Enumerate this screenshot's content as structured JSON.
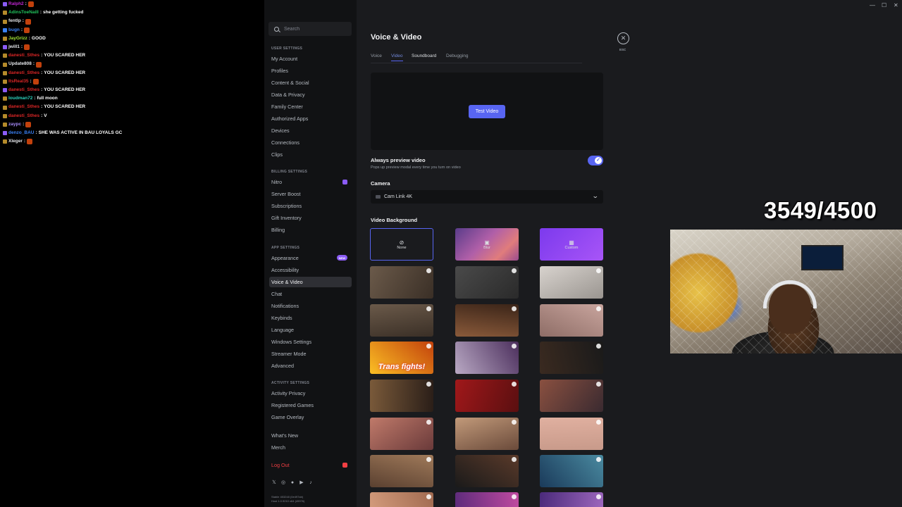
{
  "chat": {
    "lines": [
      {
        "user": "Ralph2",
        "msg": "",
        "color": "#c026d3"
      },
      {
        "user": "AdinsToeNaill",
        "msg": "she getting fucked",
        "color": "#22c55e"
      },
      {
        "user": "fentlp",
        "msg": "",
        "color": "#e5e7eb"
      },
      {
        "user": "bugn",
        "msg": "",
        "color": "#3b82f6"
      },
      {
        "user": "JayGrizz",
        "msg": "GOOD",
        "color": "#a3e635"
      },
      {
        "user": "jwill1",
        "msg": "",
        "color": "#e5e7eb"
      },
      {
        "user": "danesti_Sthes",
        "msg": "YOU SCARED HER",
        "color": "#dc2626"
      },
      {
        "user": "Update808",
        "msg": "",
        "color": "#e5e7eb"
      },
      {
        "user": "danesti_Sthes",
        "msg": "YOU SCARED HER",
        "color": "#dc2626"
      },
      {
        "user": "ItsReal35",
        "msg": "",
        "color": "#dc2626"
      },
      {
        "user": "danesti_Sthes",
        "msg": "YOU SCARED HER",
        "color": "#dc2626"
      },
      {
        "user": "loudman72",
        "msg": "full moon",
        "color": "#2dd4bf"
      },
      {
        "user": "danesti_Sthes",
        "msg": "YOU SCARED HER",
        "color": "#dc2626"
      },
      {
        "user": "danesti_Sthes",
        "msg": "V",
        "color": "#dc2626"
      },
      {
        "user": "zaypc",
        "msg": "",
        "color": "#a78bfa"
      },
      {
        "user": "denzo_BAU",
        "msg": "SHE WAS ACTIVE IN BAU LOYALS GC",
        "color": "#3b82f6"
      },
      {
        "user": "Xleger",
        "msg": "",
        "color": "#e5e7eb"
      }
    ]
  },
  "sidebar": {
    "search_placeholder": "Search",
    "sections": {
      "user": "User Settings",
      "billing": "Billing Settings",
      "app": "App Settings",
      "activity": "Activity Settings"
    },
    "items": {
      "my_account": "My Account",
      "profiles": "Profiles",
      "content_social": "Content & Social",
      "data_privacy": "Data & Privacy",
      "family_center": "Family Center",
      "authorized_apps": "Authorized Apps",
      "devices": "Devices",
      "connections": "Connections",
      "clips": "Clips",
      "nitro": "Nitro",
      "server_boost": "Server Boost",
      "subscriptions": "Subscriptions",
      "gift_inventory": "Gift Inventory",
      "billing": "Billing",
      "appearance": "Appearance",
      "accessibility": "Accessibility",
      "voice_video": "Voice & Video",
      "chat": "Chat",
      "notifications": "Notifications",
      "keybinds": "Keybinds",
      "language": "Language",
      "windows_settings": "Windows Settings",
      "streamer_mode": "Streamer Mode",
      "advanced": "Advanced",
      "activity_privacy": "Activity Privacy",
      "registered_games": "Registered Games",
      "game_overlay": "Game Overlay",
      "whats_new": "What's New",
      "merch": "Merch",
      "log_out": "Log Out"
    },
    "new_badge": "NEW",
    "build_line1": "Stable 453248 (0e497ab)",
    "build_line2": "Host 1.0.9210 x64 (49976)"
  },
  "main": {
    "title": "Voice & Video",
    "tabs": [
      "Voice",
      "Video",
      "Soundboard",
      "Debugging"
    ],
    "active_tab": "Video",
    "close_label": "ESC",
    "test_video_label": "Test Video",
    "always_preview_label": "Always preview video",
    "always_preview_desc": "Pops up preview modal every time you turn on video",
    "always_preview_on": true,
    "camera_label": "Camera",
    "camera_value": "Cam Link 4K",
    "video_background_label": "Video Background",
    "bg_none": "None",
    "bg_blur": "Blur",
    "bg_custom": "Custom",
    "tile_caption": "Trans fights!",
    "accent_color": "#5865f2"
  },
  "overlay": {
    "counter": "3549/4500"
  }
}
